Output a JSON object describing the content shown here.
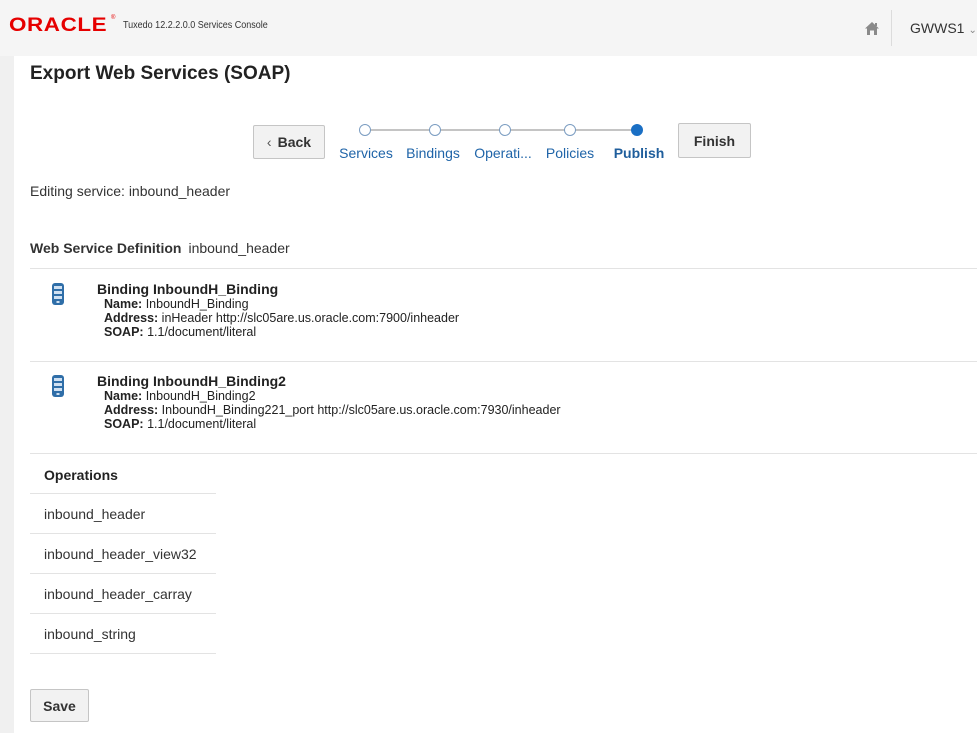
{
  "header": {
    "brand": "ORACLE",
    "brand_mark": "®",
    "app_title": "Tuxedo 12.2.2.0.0 Services Console",
    "user": "GWWS1"
  },
  "icons": {
    "home": "home-icon",
    "user_menu": "chevron-down-icon",
    "binding": "mobile-device-icon"
  },
  "page": {
    "title": "Export Web Services (SOAP)",
    "editing": "Editing service: inbound_header"
  },
  "wizard": {
    "back_label": "Back",
    "finish_label": "Finish",
    "steps": [
      {
        "label": "Services",
        "active": false
      },
      {
        "label": "Bindings",
        "active": false
      },
      {
        "label": "Operati...",
        "active": false
      },
      {
        "label": "Policies",
        "active": false
      },
      {
        "label": "Publish",
        "active": true
      }
    ]
  },
  "definition": {
    "label": "Web Service Definition",
    "value": "inbound_header"
  },
  "field_labels": {
    "name": "Name:",
    "address": "Address:",
    "soap": "SOAP:"
  },
  "bindings": [
    {
      "title": "Binding InboundH_Binding",
      "name": "InboundH_Binding",
      "address": "inHeader http://slc05are.us.oracle.com:7900/inheader",
      "soap": "1.1/document/literal"
    },
    {
      "title": "Binding InboundH_Binding2",
      "name": "InboundH_Binding2",
      "address": "InboundH_Binding221_port http://slc05are.us.oracle.com:7930/inheader",
      "soap": "1.1/document/literal"
    }
  ],
  "operations": {
    "heading": "Operations",
    "items": [
      "inbound_header",
      "inbound_header_view32",
      "inbound_header_carray",
      "inbound_string"
    ]
  },
  "actions": {
    "save_label": "Save"
  },
  "colors": {
    "brand_red": "#e60000",
    "link_blue": "#1f64a8",
    "active_step": "#1a6fc4"
  }
}
